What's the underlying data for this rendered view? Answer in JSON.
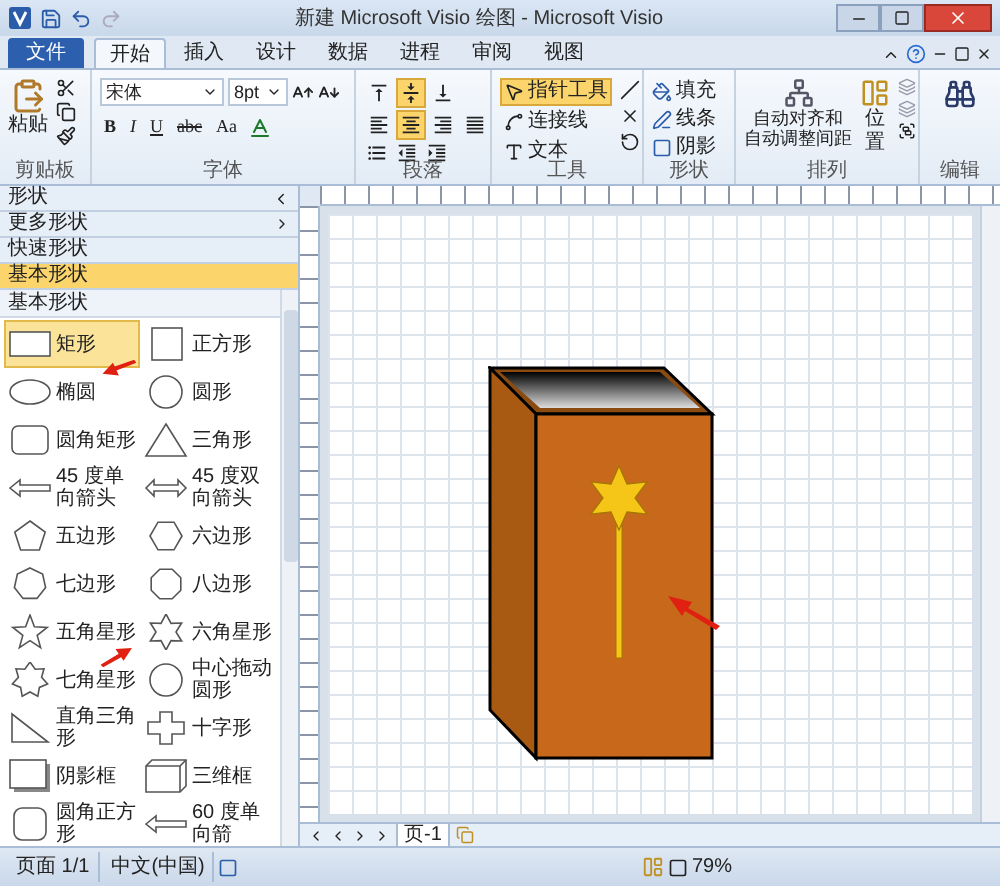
{
  "window": {
    "title": "新建 Microsoft Visio 绘图 - Microsoft Visio"
  },
  "tabs": [
    {
      "label": "文件",
      "kind": "file",
      "selected": false
    },
    {
      "label": "开始",
      "kind": "tab",
      "selected": true
    },
    {
      "label": "插入",
      "kind": "tab",
      "selected": false
    },
    {
      "label": "设计",
      "kind": "tab",
      "selected": false
    },
    {
      "label": "数据",
      "kind": "tab",
      "selected": false
    },
    {
      "label": "进程",
      "kind": "tab",
      "selected": false
    },
    {
      "label": "审阅",
      "kind": "tab",
      "selected": false
    },
    {
      "label": "视图",
      "kind": "tab",
      "selected": false
    }
  ],
  "ribbon": {
    "clipboard": {
      "paste": "粘贴",
      "label": "剪贴板"
    },
    "font": {
      "family": "宋体",
      "size": "8pt",
      "styles": [
        "B",
        "I",
        "U",
        "abc",
        "Aa"
      ],
      "label": "字体"
    },
    "paragraph": {
      "vertical_align": [
        {
          "selected": false
        },
        {
          "selected": true
        },
        {
          "selected": false
        }
      ],
      "horizontal_align": [
        {
          "selected": false
        },
        {
          "selected": true
        },
        {
          "selected": false
        },
        {
          "selected": false
        }
      ],
      "label": "段落"
    },
    "tools": {
      "items": [
        {
          "label": "指针工具",
          "selected": true
        },
        {
          "label": "连接线",
          "selected": false
        },
        {
          "label": "文本",
          "selected": false
        }
      ],
      "label": "工具"
    },
    "shape": {
      "items": [
        "填充",
        "线条",
        "阴影"
      ],
      "label": "形状"
    },
    "arrange": {
      "auto_align": [
        "自动对齐和",
        "自动调整间距"
      ],
      "position": "位置",
      "label": "排列"
    },
    "editing": {
      "label": "编辑"
    }
  },
  "shapes_panel": {
    "title": "形状",
    "sections": [
      {
        "label": "更多形状",
        "kind": "menu",
        "selected": false
      },
      {
        "label": "快速形状",
        "kind": "stencil",
        "selected": false
      },
      {
        "label": "基本形状",
        "kind": "stencil",
        "selected": true
      }
    ],
    "stencil_title": "基本形状",
    "items": [
      {
        "label": "矩形",
        "kind": "rect",
        "selected": true
      },
      {
        "label": "正方形",
        "kind": "square",
        "selected": false
      },
      {
        "label": "椭圆",
        "kind": "ellipse",
        "selected": false
      },
      {
        "label": "圆形",
        "kind": "circle",
        "selected": false
      },
      {
        "label": "圆角矩形",
        "kind": "roundrect",
        "selected": false
      },
      {
        "label": "三角形",
        "kind": "triangle",
        "selected": false
      },
      {
        "label": "45 度单向箭头",
        "kind": "arrow1",
        "selected": false
      },
      {
        "label": "45 度双向箭头",
        "kind": "arrow2",
        "selected": false
      },
      {
        "label": "五边形",
        "kind": "pentagon",
        "selected": false
      },
      {
        "label": "六边形",
        "kind": "hexagon",
        "selected": false
      },
      {
        "label": "七边形",
        "kind": "heptagon",
        "selected": false
      },
      {
        "label": "八边形",
        "kind": "octagon",
        "selected": false
      },
      {
        "label": "五角星形",
        "kind": "star5",
        "selected": false
      },
      {
        "label": "六角星形",
        "kind": "star6",
        "selected": false
      },
      {
        "label": "七角星形",
        "kind": "star7",
        "selected": false
      },
      {
        "label": "中心拖动圆形",
        "kind": "circle",
        "selected": false
      },
      {
        "label": "直角三角形",
        "kind": "righttri",
        "selected": false
      },
      {
        "label": "十字形",
        "kind": "cross",
        "selected": false
      },
      {
        "label": "阴影框",
        "kind": "shadowbox",
        "selected": false
      },
      {
        "label": "三维框",
        "kind": "box3d",
        "selected": false
      },
      {
        "label": "圆角正方形",
        "kind": "roundsquare",
        "selected": false
      },
      {
        "label": "60 度单向箭",
        "kind": "arrow1",
        "selected": false
      }
    ]
  },
  "page_tabs": [
    {
      "label": "页-1",
      "selected": true
    }
  ],
  "status_bar": {
    "page": "页面 1/1",
    "language": "中文(中国)",
    "zoom": "79%"
  }
}
